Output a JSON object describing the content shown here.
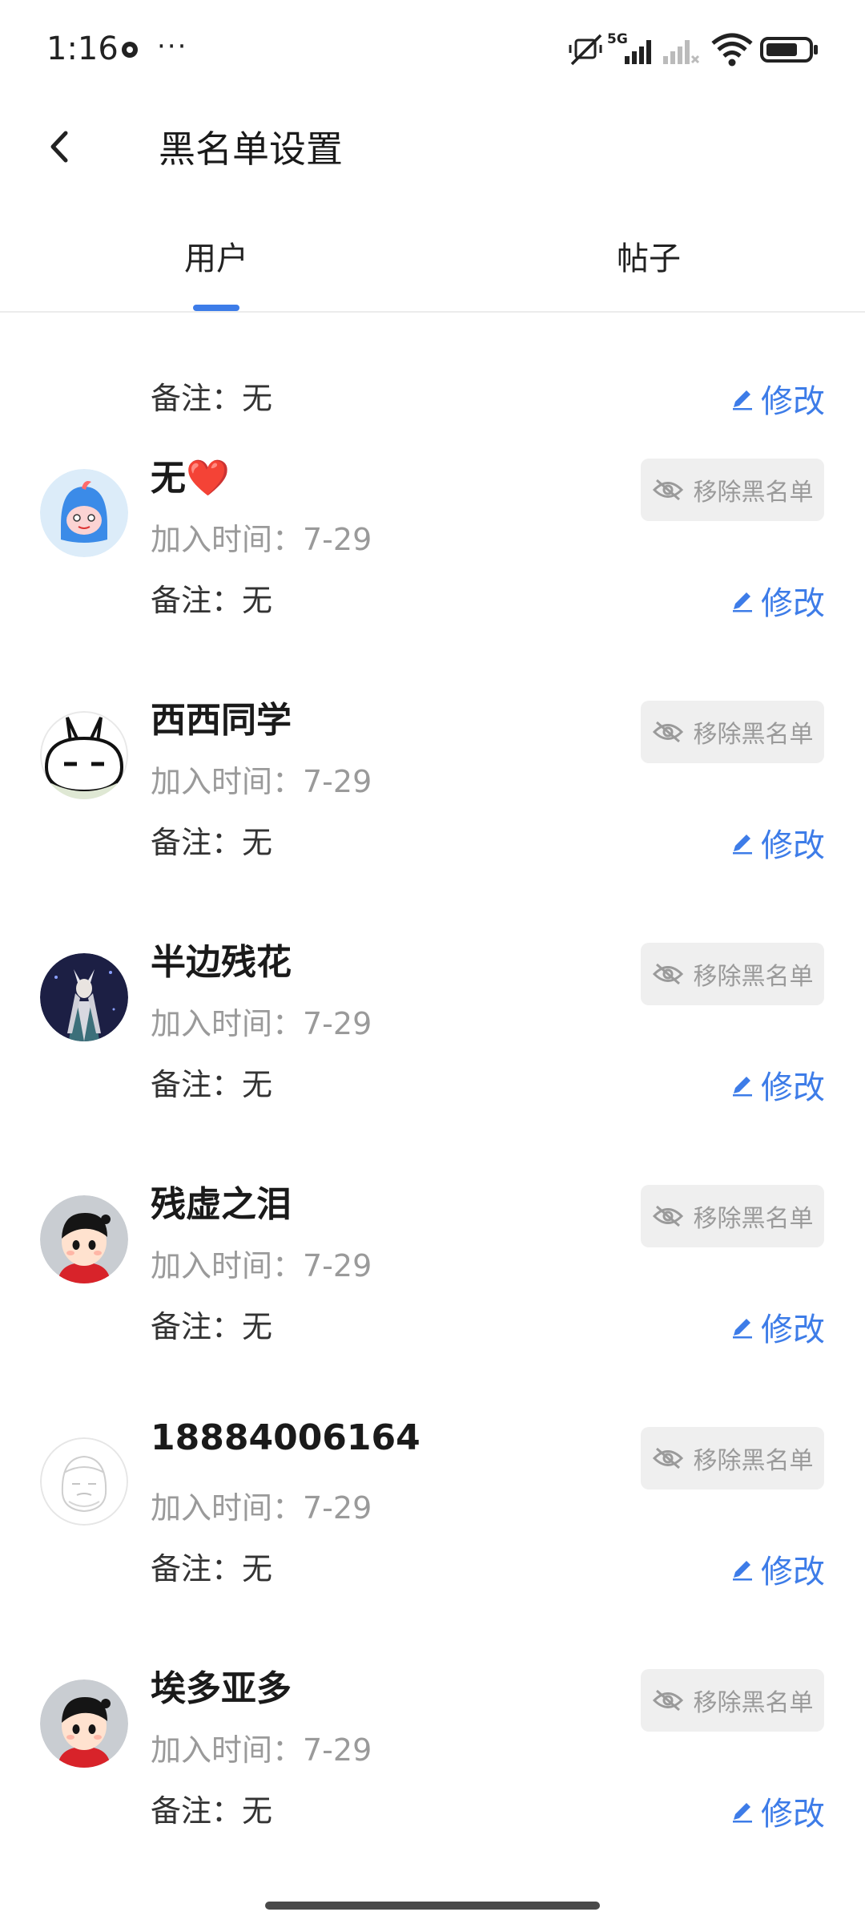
{
  "status_bar": {
    "time": "1:16",
    "more": "···",
    "network": "5G"
  },
  "header": {
    "title": "黑名单设置"
  },
  "tabs": [
    {
      "label": "用户"
    },
    {
      "label": "帖子"
    }
  ],
  "list": {
    "partial_item": {
      "remark": "备注：无",
      "edit_label": "修改"
    },
    "items": [
      {
        "name": "无",
        "name_emoji": "❤️",
        "time": "加入时间：7-29",
        "remark": "备注：无",
        "remove_label": "移除黑名单",
        "edit_label": "修改"
      },
      {
        "name": "西西同学",
        "time": "加入时间：7-29",
        "remark": "备注：无",
        "remove_label": "移除黑名单",
        "edit_label": "修改"
      },
      {
        "name": "半边残花",
        "time": "加入时间：7-29",
        "remark": "备注：无",
        "remove_label": "移除黑名单",
        "edit_label": "修改"
      },
      {
        "name": "残虚之泪",
        "time": "加入时间：7-29",
        "remark": "备注：无",
        "remove_label": "移除黑名单",
        "edit_label": "修改"
      },
      {
        "name": "18884006164",
        "time": "加入时间：7-29",
        "remark": "备注：无",
        "remove_label": "移除黑名单",
        "edit_label": "修改"
      },
      {
        "name": "埃多亚多",
        "time": "加入时间：7-29",
        "remark": "备注：无",
        "remove_label": "移除黑名单",
        "edit_label": "修改"
      }
    ]
  },
  "colors": {
    "accent": "#3d7ce8",
    "muted_text": "#9a9a9a",
    "button_bg": "#efefef"
  }
}
